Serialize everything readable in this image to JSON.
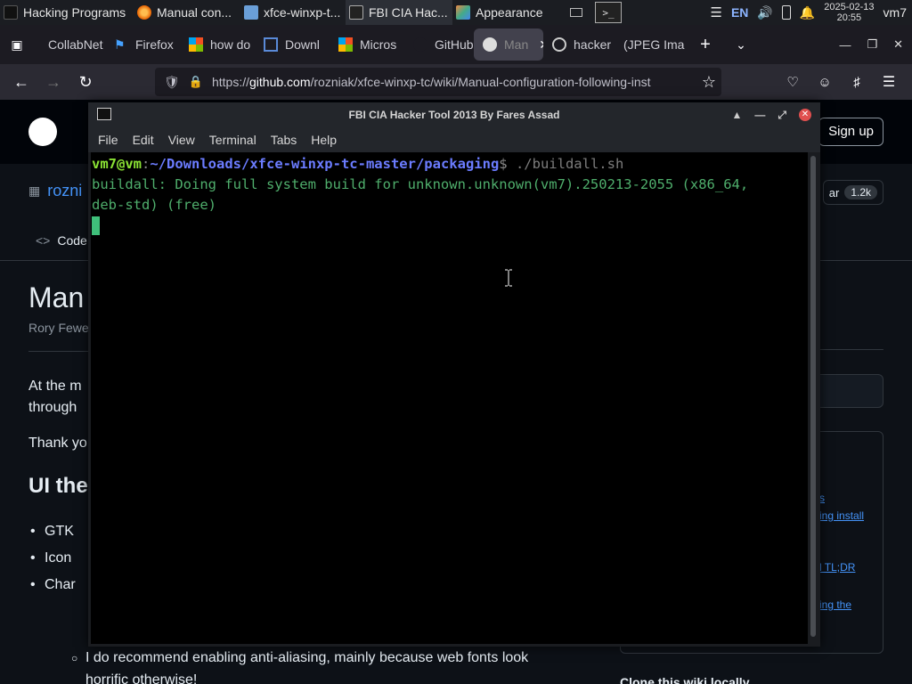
{
  "panel": {
    "tasks": [
      {
        "label": "Hacking Programs",
        "icon": "kali-icon",
        "active": false
      },
      {
        "label": "Manual con...",
        "icon": "firefox-icon",
        "active": false
      },
      {
        "label": "xfce-winxp-t...",
        "icon": "folder-icon",
        "active": false
      },
      {
        "label": "FBI CIA Hac...",
        "icon": "terminal-icon",
        "active": true
      },
      {
        "label": "Appearance",
        "icon": "appearance-icon",
        "active": false
      }
    ],
    "lang": "EN",
    "date": "2025-02-13",
    "time": "20:55",
    "user": "vm7"
  },
  "browser": {
    "tabs": [
      {
        "label": "CollabNet",
        "icon": "collabnet-icon"
      },
      {
        "label": "Firefox",
        "icon": "firefox-icon"
      },
      {
        "label": "how do",
        "icon": "microsoft-icon"
      },
      {
        "label": "Downl",
        "icon": "download-page-icon"
      },
      {
        "label": "Micros",
        "icon": "microsoft-icon"
      },
      {
        "label": "GitHub",
        "icon": "github-icon"
      },
      {
        "label": "Man",
        "icon": "github-icon",
        "active": true
      },
      {
        "label": "hacker",
        "icon": "google-icon"
      },
      {
        "label": "(JPEG Ima",
        "icon": "image-icon"
      }
    ],
    "url_prefix": "https://",
    "url_host": "github.com",
    "url_path": "/rozniak/xfce-winxp-tc/wiki/Manual-configuration-following-inst"
  },
  "github": {
    "sign_up": "Sign up",
    "repo": "rozni",
    "star_count": "1.2k",
    "star_label": "ar",
    "code_tab": "Code",
    "page_title": "Man",
    "author": "Rory Fewe",
    "para1_line1": "At the m",
    "para1_line2": "through",
    "para2": "Thank yo",
    "heading": "UI the",
    "bullets": [
      "GTK",
      "Icon",
      "Char"
    ],
    "sub_bullet": "I do recommend enabling anti-aliasing, mainly because web fonts look",
    "sub_bullet_cont": "horrific otherwise!",
    "side_links": [
      "s",
      "ing install",
      "l TL;DR",
      "ing the"
    ],
    "clone_heading": "Clone this wiki locally"
  },
  "terminal": {
    "title": "FBI CIA Hacker Tool 2013 By Fares Assad",
    "menu": [
      "File",
      "Edit",
      "View",
      "Terminal",
      "Tabs",
      "Help"
    ],
    "prompt_user": "vm7@vm",
    "prompt_colon": ":",
    "prompt_path": "~/Downloads/xfce-winxp-tc-master/packaging",
    "prompt_dollar": "$",
    "command": " ./buildall.sh",
    "output_line1": "buildall: Doing full system build for unknown.unknown(vm7).250213-2055 (x86_64,",
    "output_line2": "deb-std) (free)"
  }
}
